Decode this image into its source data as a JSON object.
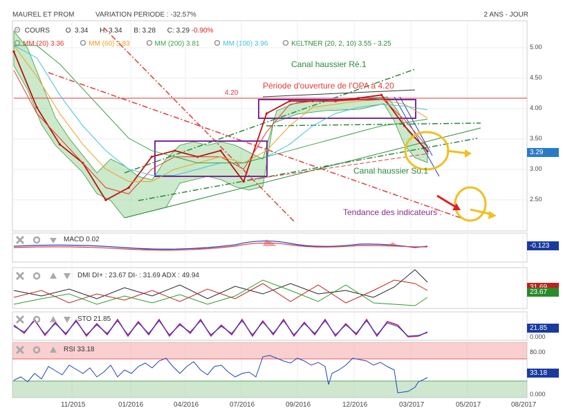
{
  "header": {
    "symbol": "MAUREL ET PROM",
    "variation_label": "VARIATION PERIODE :",
    "variation_value": "-32.57%",
    "period": "2 ANS - JOUR"
  },
  "legend_main": {
    "cours": {
      "label": "COURS",
      "o": "O: 3.34",
      "h": "H: 3.34",
      "b": "B: 3.28",
      "c_label": "C: 3.29",
      "c_change": "-0.90%"
    },
    "mm20": {
      "label": "MM (20)",
      "value": "3.36",
      "color": "#e8332a"
    },
    "mm60": {
      "label": "MM (60)",
      "value": "3.83",
      "color": "#f0a020"
    },
    "mm200": {
      "label": "MM (200)",
      "value": "3.81",
      "color": "#3aa04a"
    },
    "mm100": {
      "label": "MM (100)",
      "value": "3.96",
      "color": "#40c0e0"
    },
    "keltner": {
      "label": "KELTNER (20, 2, 10)",
      "value": "3.55 - 3.25",
      "color": "#2a8a3a"
    }
  },
  "annotations": {
    "canal_re": "Canal haussier Ré.1",
    "opa": "Période d'ouverture de l'OPA à 4.20",
    "opa_level": "4.20",
    "canal_su": "Canal haussier Su.1",
    "tendance": "Tendance des indicateurs :"
  },
  "main_axis": {
    "ticks": [
      "5.00",
      "4.50",
      "4.00",
      "3.50",
      "3.00",
      "2.50"
    ],
    "current": "3.29"
  },
  "macd": {
    "label": "MACD",
    "value": "0.02",
    "tag": "-0.123"
  },
  "dmi": {
    "label": "DMI",
    "di_plus": "DI+ : 23.67",
    "di_minus": "DI- : 31.69",
    "adx": "ADX : 49.94",
    "tag_red": "31.69",
    "tag_green": "23.67"
  },
  "sto": {
    "label": "STO",
    "value": "21.85",
    "tick": "0.000",
    "tag": "21.85"
  },
  "rsi": {
    "label": "RSI",
    "value": "33.18",
    "ticks": [
      "80.00",
      "0.000"
    ],
    "tag": "33.18"
  },
  "x_axis": [
    "11/2015",
    "01/2016",
    "04/2016",
    "07/2016",
    "09/2016",
    "12/2016",
    "03/2017",
    "05/2017",
    "08/2017"
  ],
  "chart_data": {
    "type": "line",
    "x": [
      "2015-09",
      "2015-10",
      "2015-11",
      "2015-12",
      "2016-01",
      "2016-02",
      "2016-03",
      "2016-04",
      "2016-05",
      "2016-06",
      "2016-07",
      "2016-08",
      "2016-09",
      "2016-10",
      "2016-11",
      "2016-12",
      "2017-01",
      "2017-02",
      "2017-03"
    ],
    "series": [
      {
        "name": "COURS",
        "values": [
          4.9,
          4.0,
          3.4,
          3.1,
          2.5,
          2.7,
          3.2,
          3.3,
          3.2,
          3.3,
          2.8,
          3.9,
          4.1,
          4.1,
          4.1,
          4.15,
          4.2,
          3.7,
          3.29
        ]
      },
      {
        "name": "MM (20)",
        "values": [
          4.6,
          3.9,
          3.5,
          3.1,
          2.7,
          2.6,
          3.0,
          3.2,
          3.2,
          3.2,
          3.0,
          3.6,
          4.05,
          4.1,
          4.1,
          4.12,
          4.15,
          3.8,
          3.36
        ]
      },
      {
        "name": "MM (60)",
        "values": [
          5.0,
          4.5,
          3.9,
          3.4,
          3.0,
          2.8,
          2.8,
          3.0,
          3.1,
          3.2,
          3.1,
          3.3,
          3.7,
          4.0,
          4.05,
          4.1,
          4.12,
          4.05,
          3.83
        ]
      },
      {
        "name": "MM (100)",
        "values": [
          5.0,
          4.8,
          4.2,
          3.7,
          3.3,
          3.0,
          2.9,
          2.9,
          3.0,
          3.1,
          3.1,
          3.2,
          3.4,
          3.7,
          3.9,
          4.0,
          4.05,
          4.02,
          3.96
        ]
      },
      {
        "name": "MM (200)",
        "values": [
          5.0,
          5.0,
          4.7,
          4.3,
          3.9,
          3.5,
          3.3,
          3.2,
          3.1,
          3.1,
          3.1,
          3.2,
          3.3,
          3.4,
          3.5,
          3.6,
          3.7,
          3.75,
          3.81
        ]
      }
    ],
    "ylim": [
      2.0,
      5.4
    ]
  }
}
